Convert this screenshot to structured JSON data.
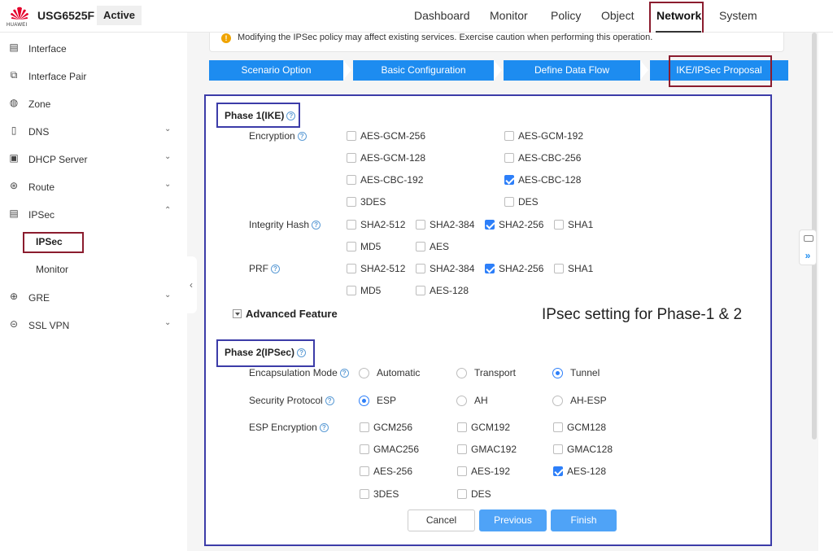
{
  "header": {
    "brand": "HUAWEI",
    "device_name": "USG6525F",
    "status": "Active",
    "nav": [
      "Dashboard",
      "Monitor",
      "Policy",
      "Object",
      "Network",
      "System"
    ],
    "active_nav": "Network"
  },
  "sidebar": {
    "items": [
      {
        "label": "Interface",
        "icon": "interface-icon"
      },
      {
        "label": "Interface Pair",
        "icon": "interface-pair-icon"
      },
      {
        "label": "Zone",
        "icon": "zone-icon"
      },
      {
        "label": "DNS",
        "icon": "dns-icon"
      },
      {
        "label": "DHCP Server",
        "icon": "dhcp-icon"
      },
      {
        "label": "Route",
        "icon": "route-icon"
      },
      {
        "label": "IPSec",
        "icon": "ipsec-icon"
      },
      {
        "label": "GRE",
        "icon": "gre-icon"
      },
      {
        "label": "SSL VPN",
        "icon": "ssl-vpn-icon"
      }
    ],
    "ipsec_sub": [
      "IPSec",
      "Monitor"
    ]
  },
  "warning": "Modifying the IPSec policy may affect existing services. Exercise caution when performing this operation.",
  "steps": [
    "Scenario Option",
    "Basic Configuration",
    "Define Data Flow",
    "IKE/IPSec Proposal"
  ],
  "phase1": {
    "title": "Phase 1(IKE)",
    "encryption_label": "Encryption",
    "encryption": [
      {
        "label": "AES-GCM-256",
        "checked": false
      },
      {
        "label": "AES-GCM-192",
        "checked": false
      },
      {
        "label": "AES-GCM-128",
        "checked": false
      },
      {
        "label": "AES-CBC-256",
        "checked": false
      },
      {
        "label": "AES-CBC-192",
        "checked": false
      },
      {
        "label": "AES-CBC-128",
        "checked": true
      },
      {
        "label": "3DES",
        "checked": false
      },
      {
        "label": "DES",
        "checked": false
      }
    ],
    "integrity_label": "Integrity Hash",
    "integrity": [
      {
        "label": "SHA2-512",
        "checked": false
      },
      {
        "label": "SHA2-384",
        "checked": false
      },
      {
        "label": "SHA2-256",
        "checked": true
      },
      {
        "label": "SHA1",
        "checked": false
      },
      {
        "label": "MD5",
        "checked": false
      },
      {
        "label": "AES",
        "checked": false
      }
    ],
    "prf_label": "PRF",
    "prf": [
      {
        "label": "SHA2-512",
        "checked": false
      },
      {
        "label": "SHA2-384",
        "checked": false
      },
      {
        "label": "SHA2-256",
        "checked": true
      },
      {
        "label": "SHA1",
        "checked": false
      },
      {
        "label": "MD5",
        "checked": false
      },
      {
        "label": "AES-128",
        "checked": false
      }
    ]
  },
  "advanced_feature": "Advanced Feature",
  "annotation": "IPsec setting for Phase-1 & 2",
  "phase2": {
    "title": "Phase 2(IPSec)",
    "encap_label": "Encapsulation Mode",
    "encap": [
      {
        "label": "Automatic",
        "checked": false
      },
      {
        "label": "Transport",
        "checked": false
      },
      {
        "label": "Tunnel",
        "checked": true
      }
    ],
    "protocol_label": "Security Protocol",
    "protocol": [
      {
        "label": "ESP",
        "checked": true
      },
      {
        "label": "AH",
        "checked": false
      },
      {
        "label": "AH-ESP",
        "checked": false
      }
    ],
    "esp_label": "ESP Encryption",
    "esp": [
      {
        "label": "GCM256",
        "checked": false
      },
      {
        "label": "GCM192",
        "checked": false
      },
      {
        "label": "GCM128",
        "checked": false
      },
      {
        "label": "GMAC256",
        "checked": false
      },
      {
        "label": "GMAC192",
        "checked": false
      },
      {
        "label": "GMAC128",
        "checked": false
      },
      {
        "label": "AES-256",
        "checked": false
      },
      {
        "label": "AES-192",
        "checked": false
      },
      {
        "label": "AES-128",
        "checked": true
      },
      {
        "label": "3DES",
        "checked": false
      },
      {
        "label": "DES",
        "checked": false
      }
    ]
  },
  "buttons": {
    "cancel": "Cancel",
    "previous": "Previous",
    "finish": "Finish"
  },
  "colors": {
    "accent": "#1d8cf0",
    "highlight_red": "#8b1c2e",
    "highlight_blue": "#3c3ca8"
  }
}
